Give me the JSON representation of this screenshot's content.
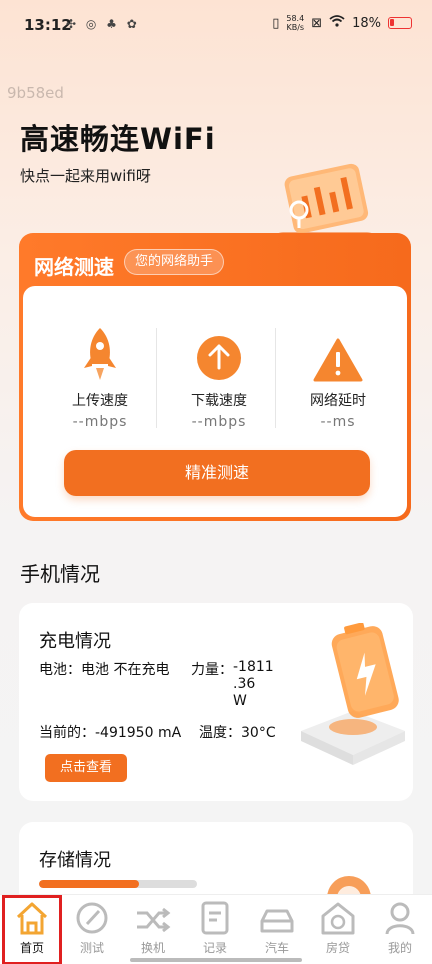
{
  "status_bar": {
    "time": "13:12",
    "net_speed_value": "58.4",
    "net_speed_unit": "KB/s",
    "battery_percent": "18%"
  },
  "watermark": "9b58ed",
  "hero": {
    "title": "高速畅连WiFi",
    "subtitle": "快点一起来用wifi呀"
  },
  "speed_test": {
    "title": "网络测速",
    "tag": "您的网络助手",
    "metrics": [
      {
        "label": "上传速度",
        "value": "--mbps",
        "icon": "rocket-icon"
      },
      {
        "label": "下载速度",
        "value": "--mbps",
        "icon": "arrow-up-circle-icon"
      },
      {
        "label": "网络延时",
        "value": "--ms",
        "icon": "warning-triangle-icon"
      }
    ],
    "button_label": "精准测速"
  },
  "phone_status": {
    "section_title": "手机情况",
    "charging": {
      "title": "充电情况",
      "battery_label": "电池：",
      "battery_value": "电池 不在充电",
      "power_label": "力量：",
      "power_value_line1": "-1811",
      "power_value_line2": ".36",
      "power_value_line3": "W",
      "current_label": "当前的：",
      "current_value": "-491950 mA",
      "temp_label": "温度：",
      "temp_value": "30°C",
      "view_button": "点击查看"
    },
    "storage": {
      "title": "存储情况",
      "used_fraction": 0.63
    }
  },
  "tabbar": {
    "tabs": [
      {
        "label": "首页",
        "icon": "home-icon",
        "active": true
      },
      {
        "label": "测试",
        "icon": "gauge-icon",
        "active": false
      },
      {
        "label": "换机",
        "icon": "shuffle-icon",
        "active": false
      },
      {
        "label": "记录",
        "icon": "document-icon",
        "active": false
      },
      {
        "label": "汽车",
        "icon": "car-icon",
        "active": false
      },
      {
        "label": "房贷",
        "icon": "house-money-icon",
        "active": false
      },
      {
        "label": "我的",
        "icon": "user-icon",
        "active": false
      }
    ]
  },
  "colors": {
    "accent": "#f26f20",
    "highlight_frame": "#e02020"
  }
}
